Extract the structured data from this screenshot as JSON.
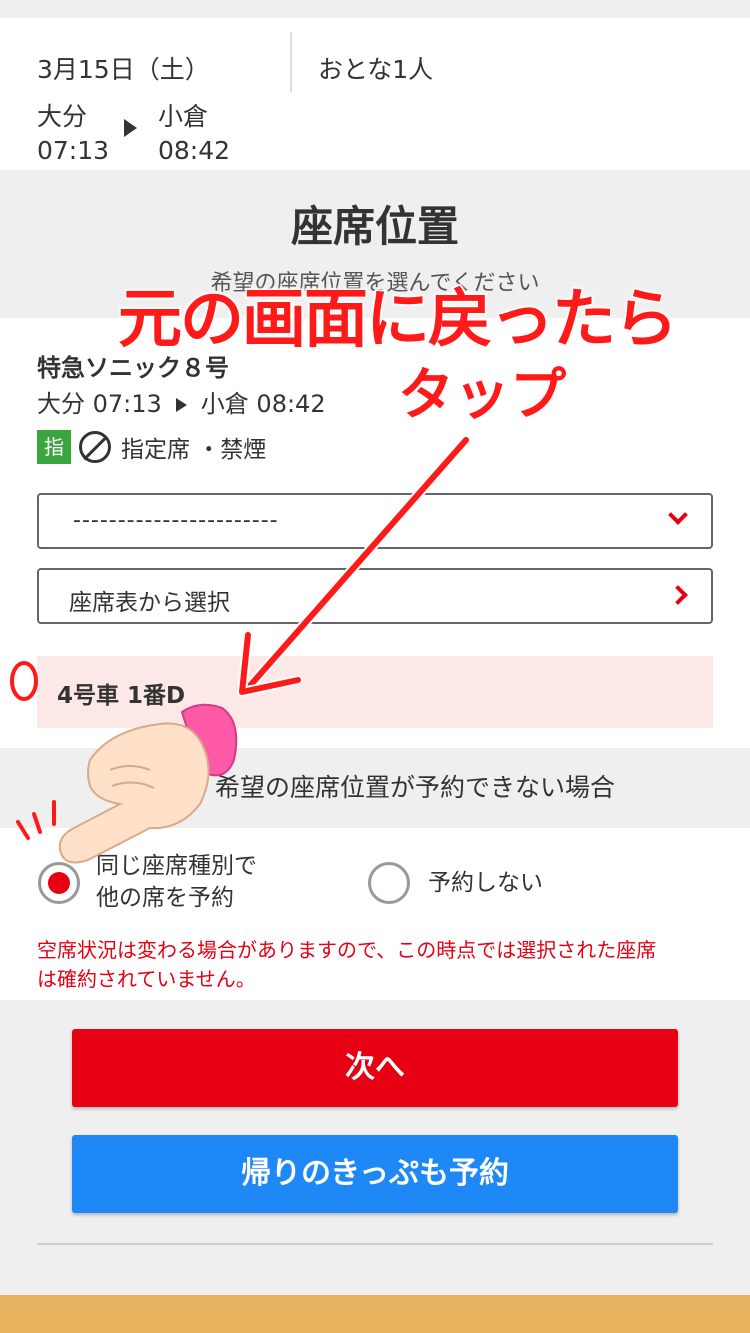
{
  "trip": {
    "date": "3月15日（土）",
    "passengers": "おとな1人",
    "from_station": "大分",
    "from_time": "07:13",
    "to_station": "小倉",
    "to_time": "08:42"
  },
  "section": {
    "title": "座席位置",
    "subtitle": "希望の座席位置を選んでください"
  },
  "train": {
    "name": "特急ソニック８号",
    "route": "大分 07:13",
    "route_to": "小倉 08:42",
    "badge": "指",
    "seat_type": "指定席 ・禁煙"
  },
  "seat_select": {
    "dropdown_value": "-----------------------",
    "map_select_label": "座席表から選択",
    "selected_seat": "4号車 1番D"
  },
  "alternate": {
    "title": "希望の座席位置が予約できない場合",
    "option1_line1": "同じ座席種別で",
    "option1_line2": "他の席を予約",
    "option2": "予約しない",
    "selected": "option1",
    "warning_line1": "空席状況は変わる場合がありますので、この時点では選択された座席",
    "warning_line2": "は確約されていません。"
  },
  "buttons": {
    "next": "次へ",
    "return_ticket": "帰りのきっぷも予約"
  },
  "overlay": {
    "headline": "元の画面に戻ったら",
    "tap": "タップ"
  },
  "colors": {
    "primary_red": "#e60012",
    "return_blue": "#1e88f6",
    "reserved_green": "#3aa640",
    "bottom_bar": "#e8b35e"
  },
  "icons": {
    "reserved": "reserved-seat-badge",
    "no_smoking": "no-smoking-icon",
    "dropdown": "chevron-down-icon",
    "seatmap": "chevron-right-icon"
  }
}
